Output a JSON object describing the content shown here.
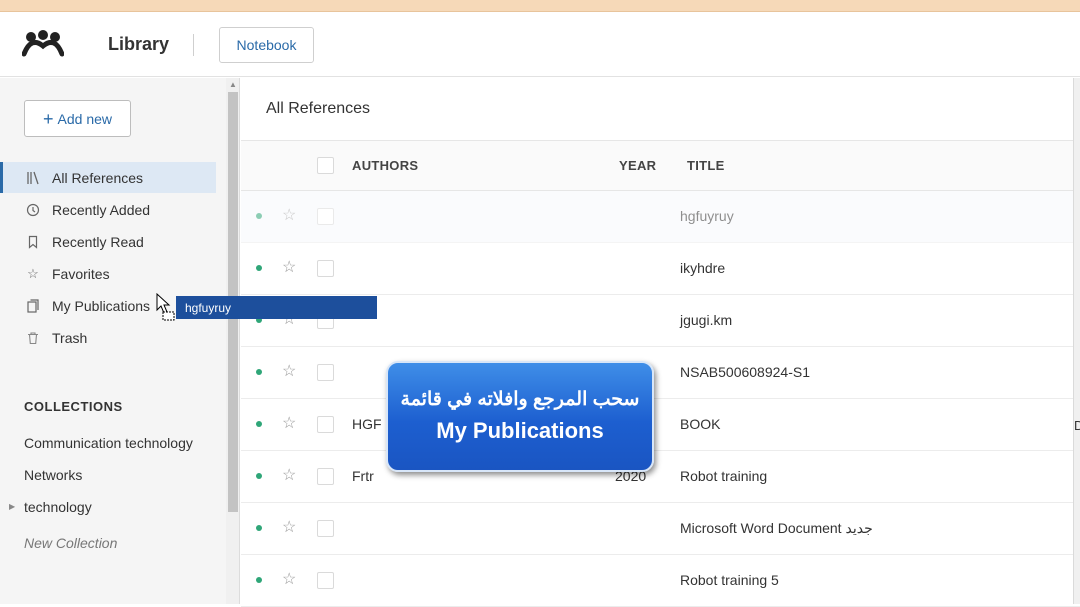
{
  "header": {
    "app_title": "Library",
    "notebook_label": "Notebook"
  },
  "sidebar": {
    "add_new_label": "Add new",
    "nav_items": [
      {
        "label": "All References",
        "icon": "library-icon",
        "active": true
      },
      {
        "label": "Recently Added",
        "icon": "clock-icon"
      },
      {
        "label": "Recently Read",
        "icon": "bookmark-icon"
      },
      {
        "label": "Favorites",
        "icon": "star-icon"
      },
      {
        "label": "My Publications",
        "icon": "publication-icon"
      },
      {
        "label": "Trash",
        "icon": "trash-icon"
      }
    ],
    "collections_heading": "COLLECTIONS",
    "collections": [
      "Communication technology",
      "Networks",
      "technology"
    ],
    "new_collection_label": "New Collection"
  },
  "main": {
    "title": "All References",
    "columns": {
      "authors": "AUTHORS",
      "year": "YEAR",
      "title": "TITLE"
    },
    "rows": [
      {
        "authors": "",
        "year": "",
        "title": "hgfuyruy"
      },
      {
        "authors": "",
        "year": "",
        "title": "ikyhdre"
      },
      {
        "authors": "",
        "year": "",
        "title": "jgugi.km"
      },
      {
        "authors": "",
        "year": "",
        "title": "NSAB500608924-S1"
      },
      {
        "authors": "HGF",
        "year": "",
        "title": "BOOK"
      },
      {
        "authors": "Frtr",
        "year": "2020",
        "title": "Robot training"
      },
      {
        "authors": "",
        "year": "",
        "title": "Microsoft Word Document جديد"
      },
      {
        "authors": "",
        "year": "",
        "title": "Robot training 5"
      }
    ],
    "right_edge_char": "D"
  },
  "drag": {
    "chip_label": "hgfuyruy"
  },
  "overlay": {
    "line1": "سحب المرجع وافلاته في قائمة",
    "line2": "My Publications"
  },
  "colors": {
    "accent": "#2a6aa8",
    "unread_dot": "#2fa678",
    "drag_chip": "#1d4f9c",
    "overlay_blue": "#1d5fd0"
  }
}
